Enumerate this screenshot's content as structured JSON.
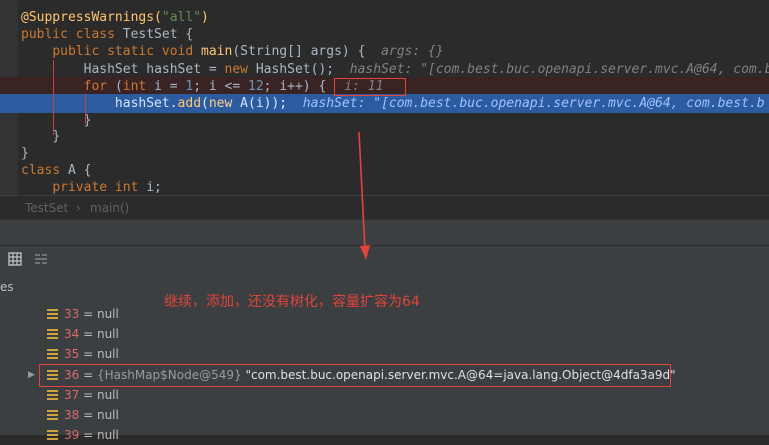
{
  "editor": {
    "lines": [
      {
        "ann": "@SuppressWarnings(",
        "str": "\"all\"",
        "close": ")"
      },
      {
        "kw1": "public class ",
        "name": "TestSet",
        "rest": " {"
      },
      {
        "indent": "    ",
        "kw1": "public static void ",
        "name": "main",
        "rest": "(String[] args) {  ",
        "hint": "args: {}"
      },
      {
        "indent": "        ",
        "code": "HashSet hashSet = ",
        "kw1": "new ",
        "name": "HashSet",
        "rest": "();  ",
        "hint": "hashSet: \"[com.best.buc.openapi.server.mvc.A@64, com.b"
      },
      {
        "indent": "        ",
        "kw1": "for ",
        "rest": "(",
        "kw2": "int ",
        "code": "i = ",
        "num1": "1",
        "mid": "; i <= ",
        "num2": "12",
        "end": "; i++) {",
        "hint": "i: 11"
      },
      {
        "indent": "            ",
        "code": "hashSet.",
        "name": "add",
        "rest": "(",
        "kw1": "new ",
        "cls": "A",
        "end": "(i));  ",
        "hint": "hashSet: \"[com.best.buc.openapi.server.mvc.A@64, com.best.b"
      },
      {
        "indent": "        ",
        "code": "}"
      },
      {
        "indent": "    ",
        "code": "}"
      },
      {
        "code": "}"
      },
      {
        "kw1": "class ",
        "name": "A",
        "rest": " {"
      },
      {
        "indent": "    ",
        "kw1": "private int ",
        "code": "i;"
      }
    ]
  },
  "breadcrumb": {
    "first": "TestSet",
    "sep": "›",
    "second": "main()"
  },
  "panel": {
    "tab_fragment": "es"
  },
  "annotation": {
    "note": "继续，添加，还没有树化，容量扩容为64"
  },
  "variables": [
    {
      "index": "33",
      "eq": " = ",
      "value": "null"
    },
    {
      "index": "34",
      "eq": " = ",
      "value": "null"
    },
    {
      "index": "35",
      "eq": " = ",
      "value": "null"
    },
    {
      "index": "36",
      "eq": " = ",
      "node": "{HashMap$Node@549} ",
      "value": "\"com.best.buc.openapi.server.mvc.A@64=java.lang.Object@4dfa3a9d\"",
      "expandable": true
    },
    {
      "index": "37",
      "eq": " = ",
      "value": "null"
    },
    {
      "index": "38",
      "eq": " = ",
      "value": "null"
    },
    {
      "index": "39",
      "eq": " = ",
      "value": "null"
    }
  ],
  "colors": {
    "accent_red": "#e0443a",
    "selection": "#2d5ba0",
    "field_icon": "#d1a33b"
  }
}
